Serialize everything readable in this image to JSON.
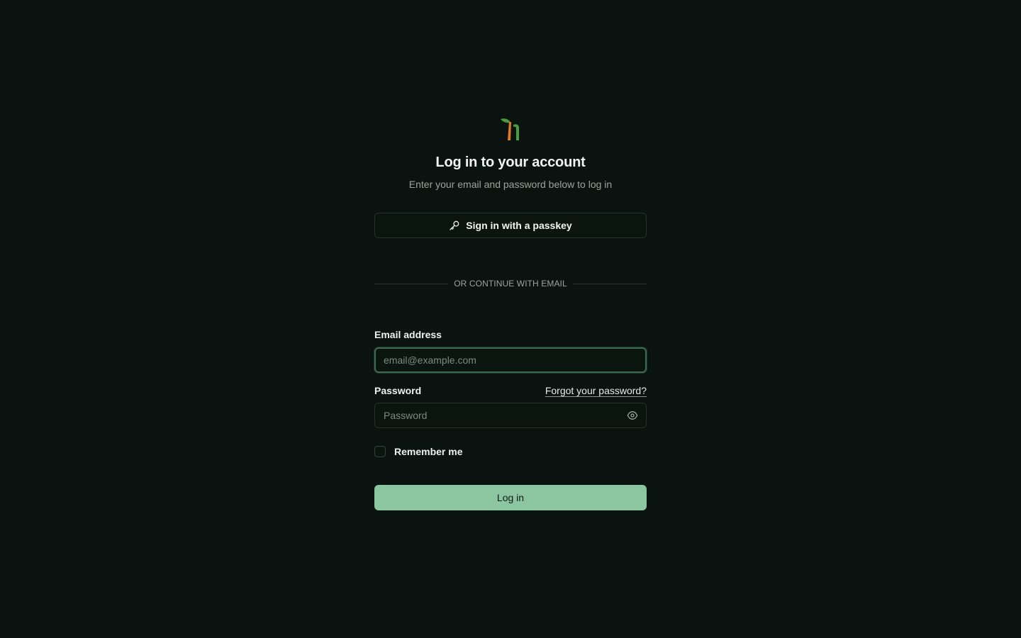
{
  "brand": {
    "logo_icon": "sprout-logo-icon",
    "leaf_color": "#4e9a43",
    "stem_color": "#e07b22"
  },
  "header": {
    "title": "Log in to your account",
    "subtitle": "Enter your email and password below to log in"
  },
  "passkey": {
    "label": "Sign in with a passkey",
    "icon": "key-icon"
  },
  "divider": {
    "text": "OR CONTINUE WITH EMAIL"
  },
  "email": {
    "label": "Email address",
    "placeholder": "email@example.com",
    "value": ""
  },
  "password": {
    "label": "Password",
    "placeholder": "Password",
    "value": "",
    "forgot_link": "Forgot your password?",
    "toggle_icon": "eye-icon"
  },
  "remember": {
    "label": "Remember me",
    "checked": false
  },
  "submit": {
    "label": "Log in"
  },
  "colors": {
    "background": "#0a130f",
    "accent": "#8cc6a1",
    "border": "#25332c",
    "muted_text": "#98a69e"
  }
}
